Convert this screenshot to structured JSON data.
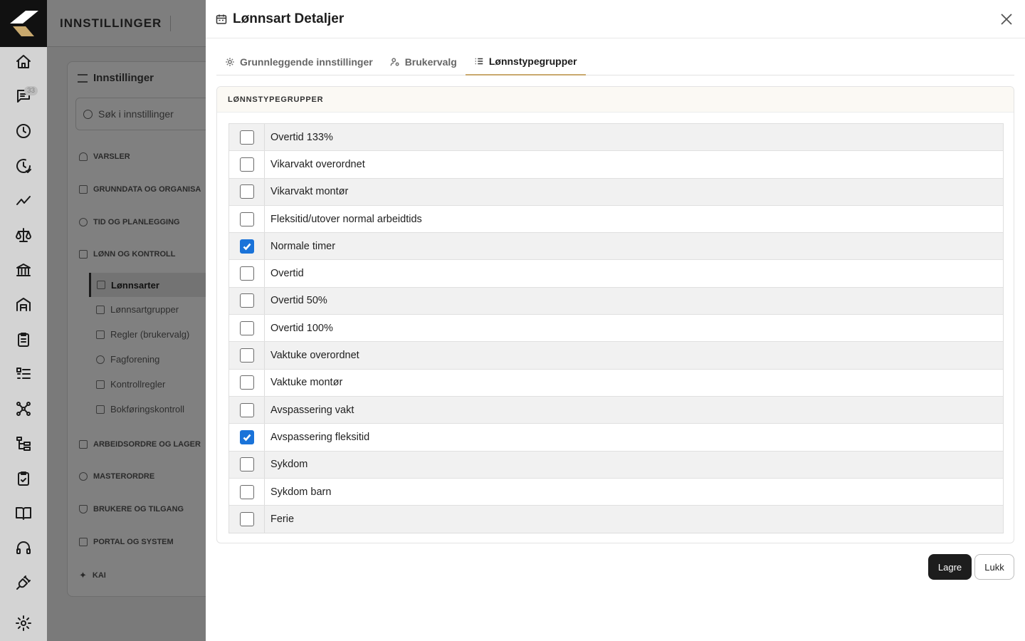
{
  "app": {
    "header_title": "INNSTILLINGER",
    "chat_badge": "33"
  },
  "rail_icons": [
    "home-icon",
    "chat-icon",
    "clock-icon",
    "clock-check-icon",
    "trend-icon",
    "scale-icon",
    "bank-icon",
    "warehouse-icon",
    "clipboard-icon",
    "list-icon",
    "network-icon",
    "tree-icon",
    "clipboard-check-icon",
    "book-icon",
    "headset-icon",
    "plug-icon",
    "gear-icon"
  ],
  "settings_panel": {
    "title": "Innstillinger",
    "search_placeholder": "Søk i innstillinger",
    "sections": {
      "varsler": "VARSLER",
      "grunndata": "GRUNNDATA OG ORGANISA",
      "tid": "TID OG PLANLEGGING",
      "lonn": "LØNN OG KONTROLL",
      "arbeidsordre": "ARBEIDSORDRE OG LAGER",
      "masterordre": "MASTERORDRE",
      "brukere": "BRUKERE OG TILGANG",
      "portal": "PORTAL OG SYSTEM",
      "kai": "KAI"
    },
    "sub_items": {
      "lonnsarter": "Lønnsarter",
      "lonnsartgrupper": "Lønnsartgrupper",
      "regler": "Regler (brukervalg)",
      "fagforening": "Fagforening",
      "kontrollregler": "Kontrollregler",
      "bokforingskontroll": "Bokføringskontroll"
    }
  },
  "modal": {
    "title": "Lønnsart Detaljer",
    "tabs": {
      "basic": "Grunnleggende innstillinger",
      "user": "Brukervalg",
      "groups": "Lønnstypegrupper"
    },
    "section_title": "LØNNSTYPEGRUPPER",
    "rows": [
      {
        "label": "Overtid 133%",
        "checked": false
      },
      {
        "label": "Vikarvakt overordnet",
        "checked": false
      },
      {
        "label": "Vikarvakt montør",
        "checked": false
      },
      {
        "label": "Fleksitid/utover normal arbeidtids",
        "checked": false
      },
      {
        "label": "Normale timer",
        "checked": true
      },
      {
        "label": "Overtid",
        "checked": false
      },
      {
        "label": "Overtid 50%",
        "checked": false
      },
      {
        "label": "Overtid 100%",
        "checked": false
      },
      {
        "label": "Vaktuke overordnet",
        "checked": false
      },
      {
        "label": "Vaktuke montør",
        "checked": false
      },
      {
        "label": "Avspassering vakt",
        "checked": false
      },
      {
        "label": "Avspassering fleksitid",
        "checked": true
      },
      {
        "label": "Sykdom",
        "checked": false
      },
      {
        "label": "Sykdom barn",
        "checked": false
      },
      {
        "label": "Ferie",
        "checked": false
      }
    ],
    "buttons": {
      "save": "Lagre",
      "close": "Lukk"
    }
  }
}
